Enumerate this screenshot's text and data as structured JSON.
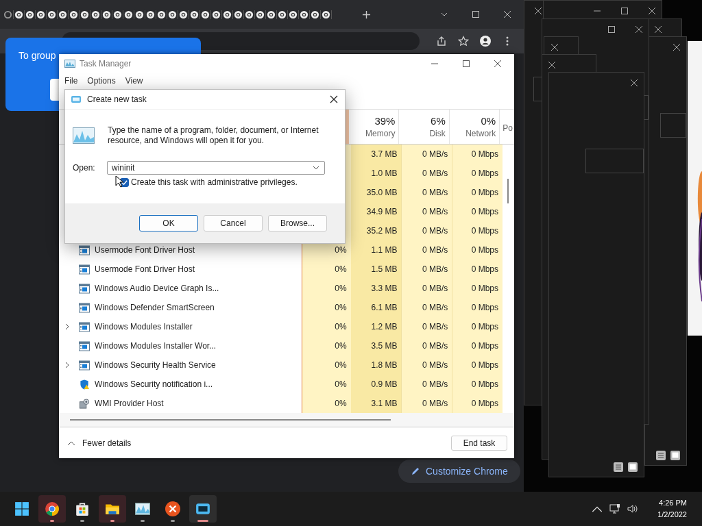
{
  "browser": {
    "tooltip": "To group",
    "customize_button": "Customize Chrome"
  },
  "task_manager": {
    "title": "Task Manager",
    "menu": [
      "File",
      "Options",
      "View"
    ],
    "columns": [
      {
        "percent": "39%",
        "label": "Memory"
      },
      {
        "percent": "6%",
        "label": "Disk"
      },
      {
        "percent": "0%",
        "label": "Network"
      },
      {
        "label": "Po"
      }
    ],
    "rows": [
      {
        "memory": "3.7 MB",
        "disk": "0 MB/s",
        "network": "0 Mbps"
      },
      {
        "memory": "1.0 MB",
        "disk": "0 MB/s",
        "network": "0 Mbps"
      },
      {
        "memory": "35.0 MB",
        "disk": "0 MB/s",
        "network": "0 Mbps"
      },
      {
        "memory": "34.9 MB",
        "disk": "0 MB/s",
        "network": "0 Mbps"
      },
      {
        "memory": "35.2 MB",
        "disk": "0 MB/s",
        "network": "0 Mbps"
      },
      {
        "name": "Usermode Font Driver Host",
        "kind": "app",
        "expandable": false,
        "cpu": "0%",
        "memory": "1.1 MB",
        "disk": "0 MB/s",
        "network": "0 Mbps"
      },
      {
        "name": "Usermode Font Driver Host",
        "kind": "app",
        "expandable": false,
        "cpu": "0%",
        "memory": "1.5 MB",
        "disk": "0 MB/s",
        "network": "0 Mbps"
      },
      {
        "name": "Windows Audio Device Graph Is...",
        "kind": "app",
        "expandable": false,
        "cpu": "0%",
        "memory": "3.3 MB",
        "disk": "0 MB/s",
        "network": "0 Mbps"
      },
      {
        "name": "Windows Defender SmartScreen",
        "kind": "app",
        "expandable": false,
        "cpu": "0%",
        "memory": "6.1 MB",
        "disk": "0 MB/s",
        "network": "0 Mbps"
      },
      {
        "name": "Windows Modules Installer",
        "kind": "app",
        "expandable": true,
        "cpu": "0%",
        "memory": "1.2 MB",
        "disk": "0 MB/s",
        "network": "0 Mbps"
      },
      {
        "name": "Windows Modules Installer Wor...",
        "kind": "app",
        "expandable": false,
        "cpu": "0%",
        "memory": "3.5 MB",
        "disk": "0 MB/s",
        "network": "0 Mbps"
      },
      {
        "name": "Windows Security Health Service",
        "kind": "app",
        "expandable": true,
        "cpu": "0%",
        "memory": "1.8 MB",
        "disk": "0 MB/s",
        "network": "0 Mbps"
      },
      {
        "name": "Windows Security notification i...",
        "kind": "shield",
        "expandable": false,
        "cpu": "0%",
        "memory": "0.9 MB",
        "disk": "0 MB/s",
        "network": "0 Mbps"
      },
      {
        "name": "WMI Provider Host",
        "kind": "service",
        "expandable": false,
        "cpu": "0%",
        "memory": "3.1 MB",
        "disk": "0 MB/s",
        "network": "0 Mbps"
      }
    ],
    "fewer_details": "Fewer details",
    "end_task": "End task"
  },
  "dialog": {
    "title": "Create new task",
    "message": "Type the name of a program, folder, document, or Internet resource, and Windows will open it for you.",
    "open_label": "Open:",
    "open_value": "wininit",
    "admin_checkbox": {
      "label": "Create this task with administrative privileges.",
      "checked": true
    },
    "buttons": [
      {
        "label": "OK",
        "default": true
      },
      {
        "label": "Cancel",
        "default": false
      },
      {
        "label": "Browse...",
        "default": false
      }
    ]
  },
  "taskbar": {
    "apps": [
      {
        "kind": "start",
        "running": false,
        "active": false,
        "flashing": false
      },
      {
        "kind": "browser",
        "running": true,
        "active": false,
        "flashing": true
      },
      {
        "kind": "store",
        "running": true,
        "active": false,
        "flashing": false
      },
      {
        "kind": "folder",
        "running": true,
        "active": false,
        "flashing": true
      },
      {
        "kind": "monitor",
        "running": true,
        "active": false,
        "flashing": false
      },
      {
        "kind": "close_app",
        "running": true,
        "active": false,
        "flashing": false
      },
      {
        "kind": "run",
        "running": true,
        "active": true,
        "flashing": false
      }
    ],
    "time": "4:26 PM",
    "date": "1/2/2022"
  }
}
